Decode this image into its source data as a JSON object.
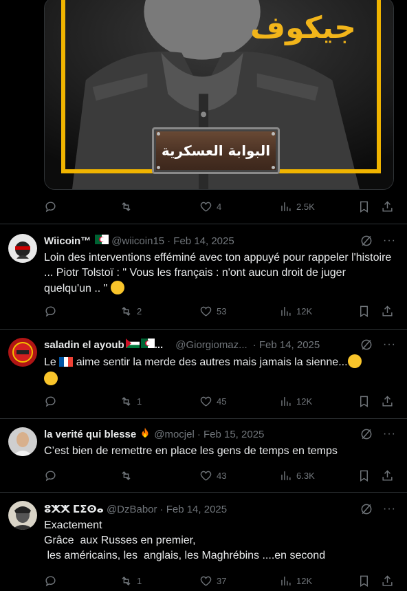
{
  "top_post": {
    "image_title_ar": "جيكوف",
    "plaque_ar": "البوابة العسكرية",
    "actions": {
      "replies": "",
      "retweets": "",
      "likes": "4",
      "views": "2.5K"
    }
  },
  "tweets": [
    {
      "name": "Wiicoin™",
      "handle": "@wiicoin15",
      "date": "· Feb 14, 2025",
      "text": "Loin des interventions efféminé avec ton appuyé pour rappeler l'histoire ... Piotr Tolstoï : \" Vous les français : n'ont aucun droit de juger quelqu'un .. \"",
      "retweets": "2",
      "likes": "53",
      "views": "12K"
    },
    {
      "name": "saladin el ayoub",
      "handle": "@Giorgiomaz...",
      "date": "· Feb 14, 2025",
      "text_a": "Le",
      "text_b": "aime sentir la merde des autres mais jamais la sienne...",
      "retweets": "1",
      "likes": "45",
      "views": "12K"
    },
    {
      "name": "la verité qui blesse",
      "handle": "@mocjel",
      "date": "· Feb 15, 2025",
      "text": "C’est bien de remettre en place les gens de temps en temps",
      "retweets": "",
      "likes": "43",
      "views": "6.3K"
    },
    {
      "name": "ⵓⵅⵅ ⵎⵉⵙⴰ",
      "handle": "@DzBabor",
      "date": "· Feb 14, 2025",
      "text": "Exactement\nGrâce  aux Russes en premier,\n les américains, les  anglais, les Maghrébins ....en second",
      "retweets": "1",
      "likes": "37",
      "views": "12K"
    }
  ],
  "colors": {
    "background": "#000000",
    "text": "#e7e9ea",
    "muted": "#71767b",
    "divider": "#2f3336",
    "accent_yellow": "#f0b400"
  },
  "icons": [
    "reply-icon",
    "retweet-icon",
    "heart-icon",
    "views-icon",
    "bookmark-icon",
    "share-icon",
    "grok-icon",
    "more-icon"
  ]
}
